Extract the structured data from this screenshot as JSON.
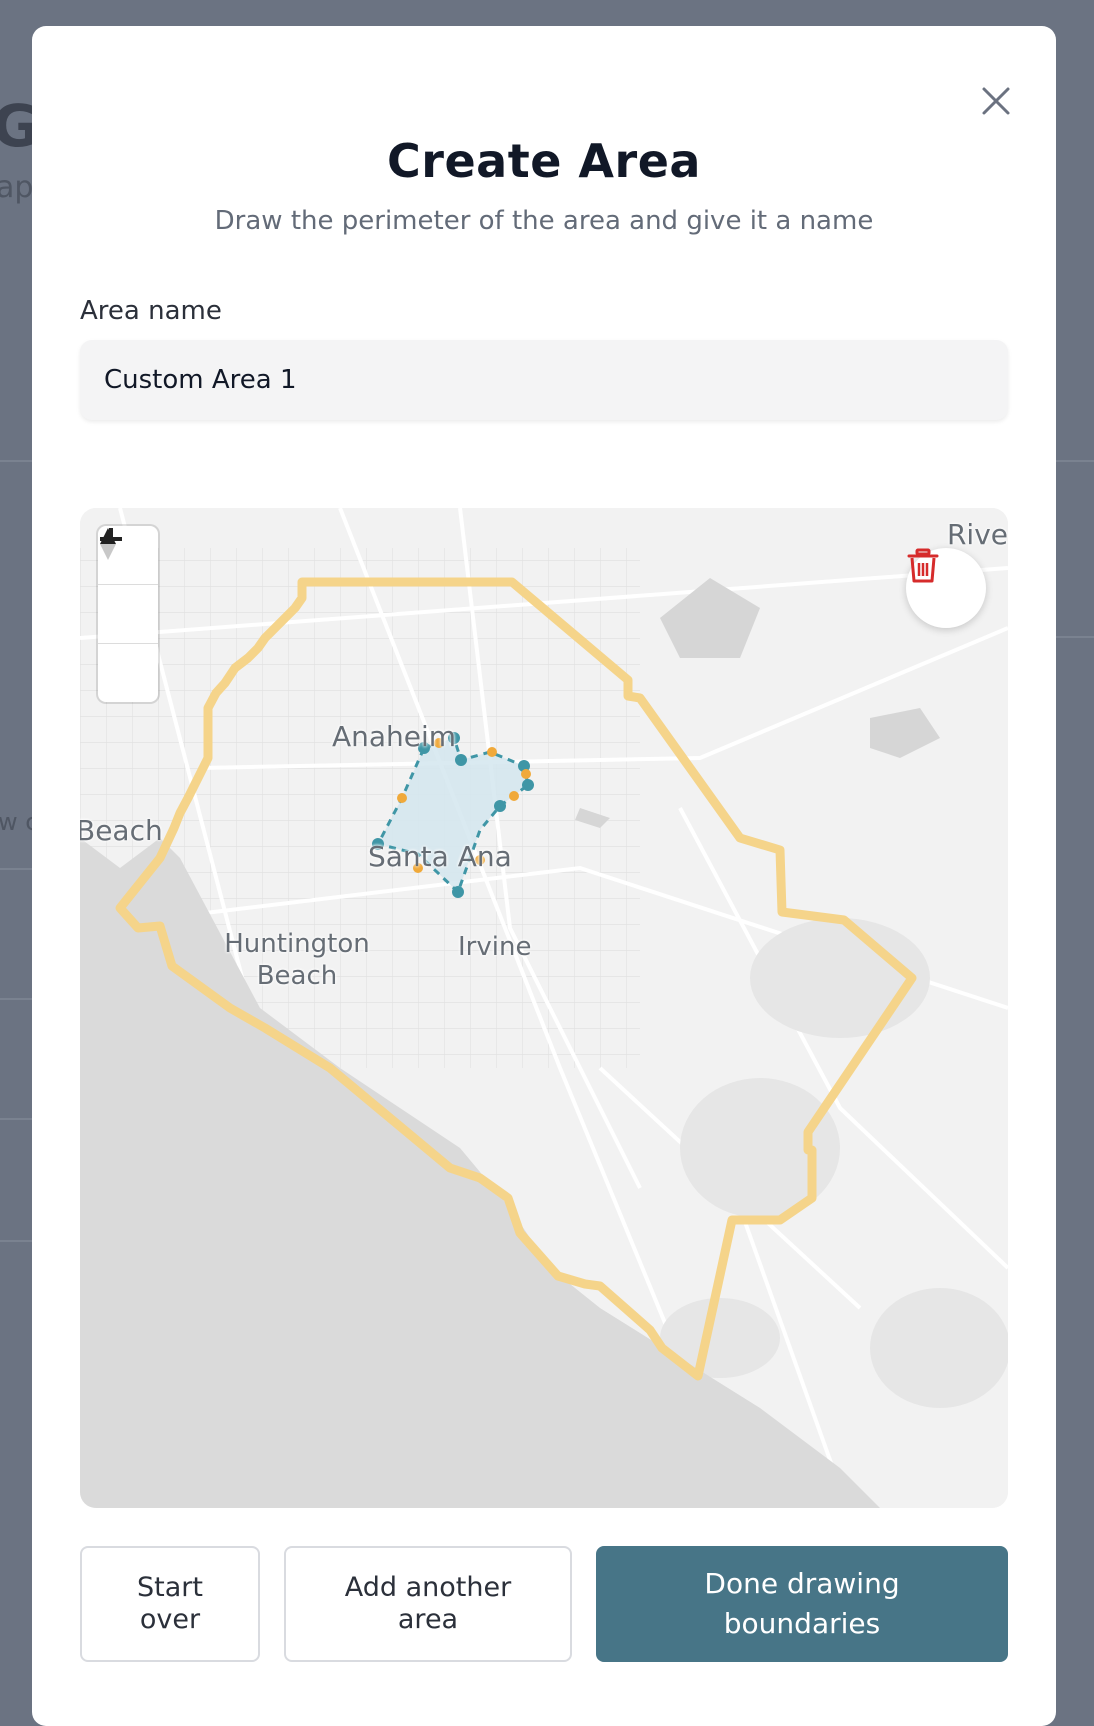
{
  "background": {
    "title_fragment": "G",
    "subtitle_fragment": "ap",
    "row_fragment": "w c"
  },
  "modal": {
    "title": "Create Area",
    "subtitle": "Draw the perimeter of the area and give it a name",
    "close_icon": "close-icon"
  },
  "area_form": {
    "label": "Area name",
    "value": "Custom Area 1",
    "placeholder": ""
  },
  "map": {
    "labels": {
      "anaheim": "Anaheim",
      "santa_ana": "Santa Ana",
      "irvine": "Irvine",
      "huntington": "Huntington Beach",
      "beach": "Beach",
      "river": "Rive"
    },
    "controls": {
      "zoom_in_icon": "plus-icon",
      "zoom_out_icon": "minus-icon",
      "compass_icon": "compass-icon",
      "delete_icon": "trash-icon"
    },
    "colors": {
      "county_outline": "#f5d48a",
      "drawn_polygon_fill": "#d3e6ee",
      "drawn_polygon_stroke": "#3f96a6",
      "vertex": "#3f96a6",
      "midpoint": "#f0a93a",
      "delete": "#d62b2b"
    }
  },
  "actions": {
    "start_over": "Start over",
    "add_another": "Add another area",
    "done": "Done drawing boundaries"
  },
  "colors": {
    "primary": "#477587",
    "overlay": "#6b7382"
  }
}
